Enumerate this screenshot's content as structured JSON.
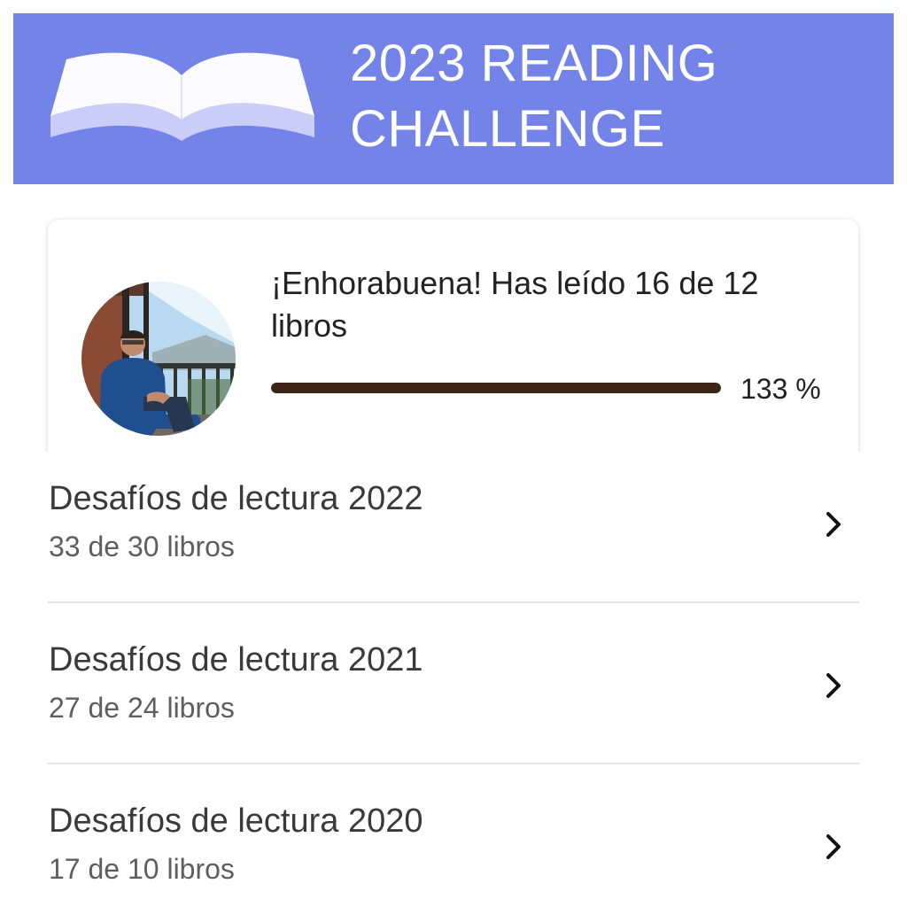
{
  "banner": {
    "title": "2023 READING\nCHALLENGE",
    "icon": "open-book-icon",
    "color": "#7483e8"
  },
  "progress": {
    "message": "¡Enhorabuena! Has leído 16 de 12 libros",
    "percent_label": "133 %",
    "percent_value": 133,
    "bar_fill_fraction": 1.0,
    "bar_color": "#3d2418"
  },
  "challenges": [
    {
      "title": "Desafíos de lectura 2022",
      "subtitle": "33 de 30 libros",
      "icon": "chevron-right-icon"
    },
    {
      "title": "Desafíos de lectura 2021",
      "subtitle": "27 de 24 libros",
      "icon": "chevron-right-icon"
    },
    {
      "title": "Desafíos de lectura 2020",
      "subtitle": "17 de 10 libros",
      "icon": "chevron-right-icon"
    }
  ]
}
